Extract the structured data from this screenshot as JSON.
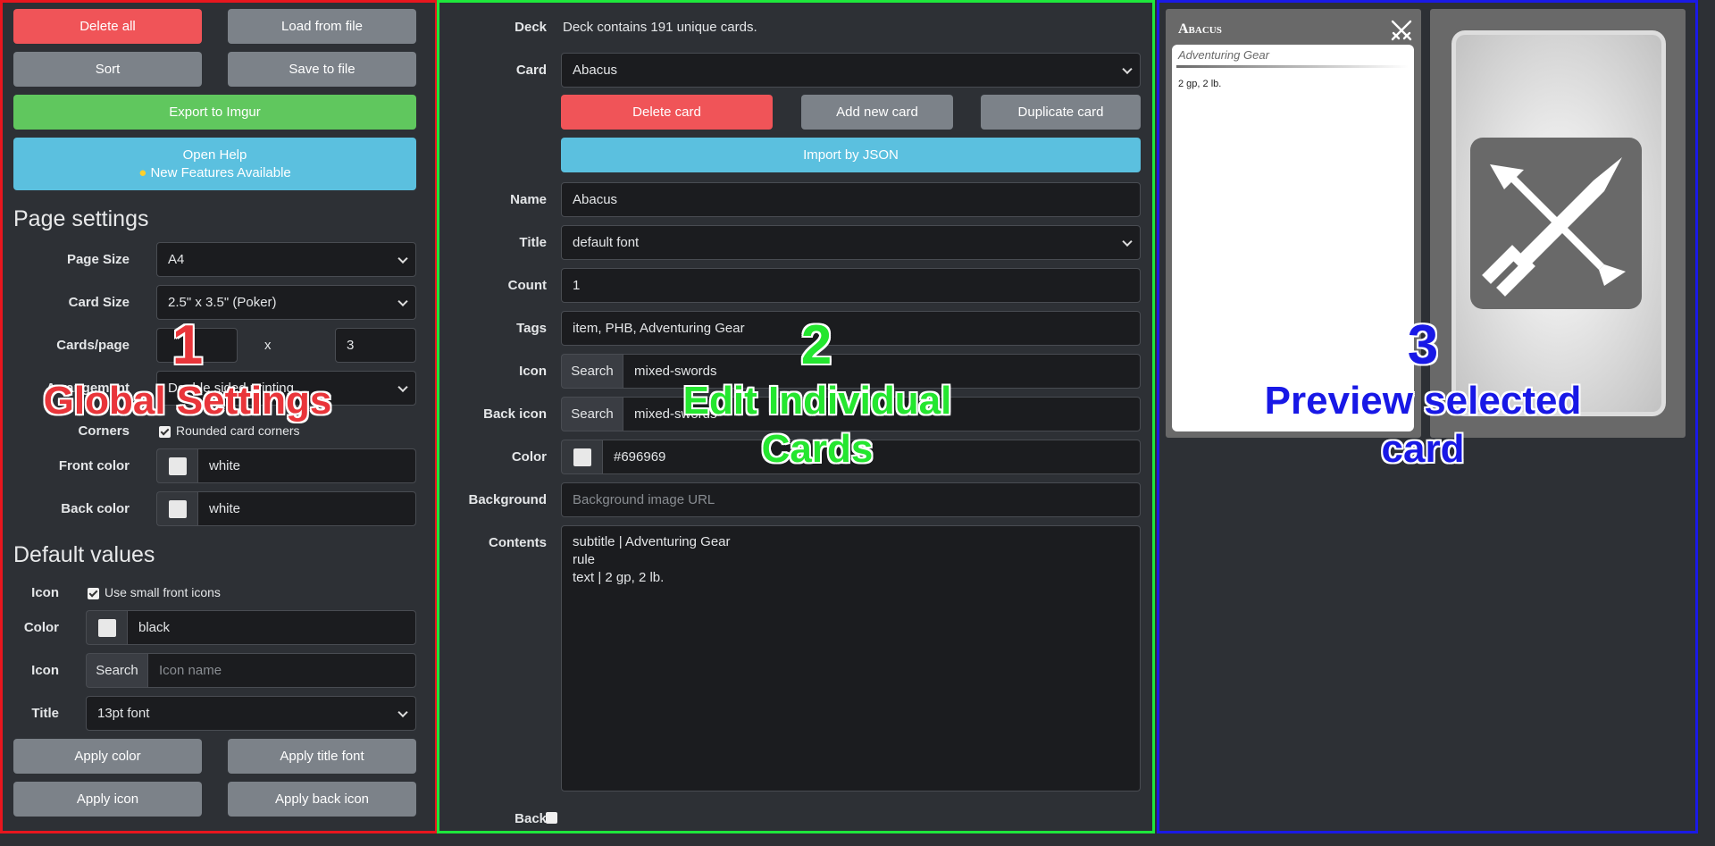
{
  "global": {
    "delete_all": "Delete all",
    "load_from_file": "Load from file",
    "sort": "Sort",
    "save_to_file": "Save to file",
    "export_imgur": "Export to Imgur",
    "open_help": "Open Help",
    "new_features": "New Features Available",
    "page_settings_heading": "Page settings",
    "page_size_label": "Page Size",
    "page_size_value": "A4",
    "card_size_label": "Card Size",
    "card_size_value": "2.5\" x 3.5\" (Poker)",
    "cards_page_label": "Cards/page",
    "cards_page_x": "x",
    "cards_page_cols": "3",
    "arrangement_label": "Arrangement",
    "arrangement_value": "Double sided printing",
    "corners_label": "Corners",
    "corners_option": "Rounded card corners",
    "front_color_label": "Front color",
    "front_color_value": "white",
    "back_color_label": "Back color",
    "back_color_value": "white",
    "default_values_heading": "Default values",
    "icon_label": "Icon",
    "small_icons_option": "Use small front icons",
    "color_label": "Color",
    "color_value": "black",
    "icon2_label": "Icon",
    "search_label": "Search",
    "icon_placeholder": "Icon name",
    "title_label": "Title",
    "title_value": "13pt font",
    "apply_color": "Apply color",
    "apply_title_font": "Apply title font",
    "apply_icon": "Apply icon",
    "apply_back_icon": "Apply back icon"
  },
  "editor": {
    "deck_label": "Deck",
    "deck_info": "Deck contains 191 unique cards.",
    "card_label": "Card",
    "card_value": "Abacus",
    "delete_card": "Delete card",
    "add_new_card": "Add new card",
    "duplicate_card": "Duplicate card",
    "import_json": "Import by JSON",
    "name_label": "Name",
    "name_value": "Abacus",
    "title_label": "Title",
    "title_value": "default font",
    "count_label": "Count",
    "count_value": "1",
    "tags_label": "Tags",
    "tags_value": "item, PHB, Adventuring Gear",
    "icon_label": "Icon",
    "search_label": "Search",
    "icon_value": "mixed-swords",
    "back_icon_label": "Back icon",
    "back_icon_value": "mixed-swords",
    "color_label": "Color",
    "color_value": "#696969",
    "background_label": "Background",
    "background_placeholder": "Background image URL",
    "contents_label": "Contents",
    "contents_value": "subtitle | Adventuring Gear\nrule\ntext | 2 gp, 2 lb.",
    "back_label": "Back"
  },
  "preview": {
    "card_title": "Abacus",
    "subtitle": "Adventuring Gear",
    "text": "2 gp, 2 lb.",
    "card_color": "#696969",
    "icon": "mixed-swords-icon"
  },
  "overlays": {
    "n1": "1",
    "t1": "Global Settings",
    "n2": "2",
    "t2a": "Edit Individual",
    "t2b": "Cards",
    "n3": "3",
    "t3a": "Preview selected",
    "t3b": "card"
  }
}
